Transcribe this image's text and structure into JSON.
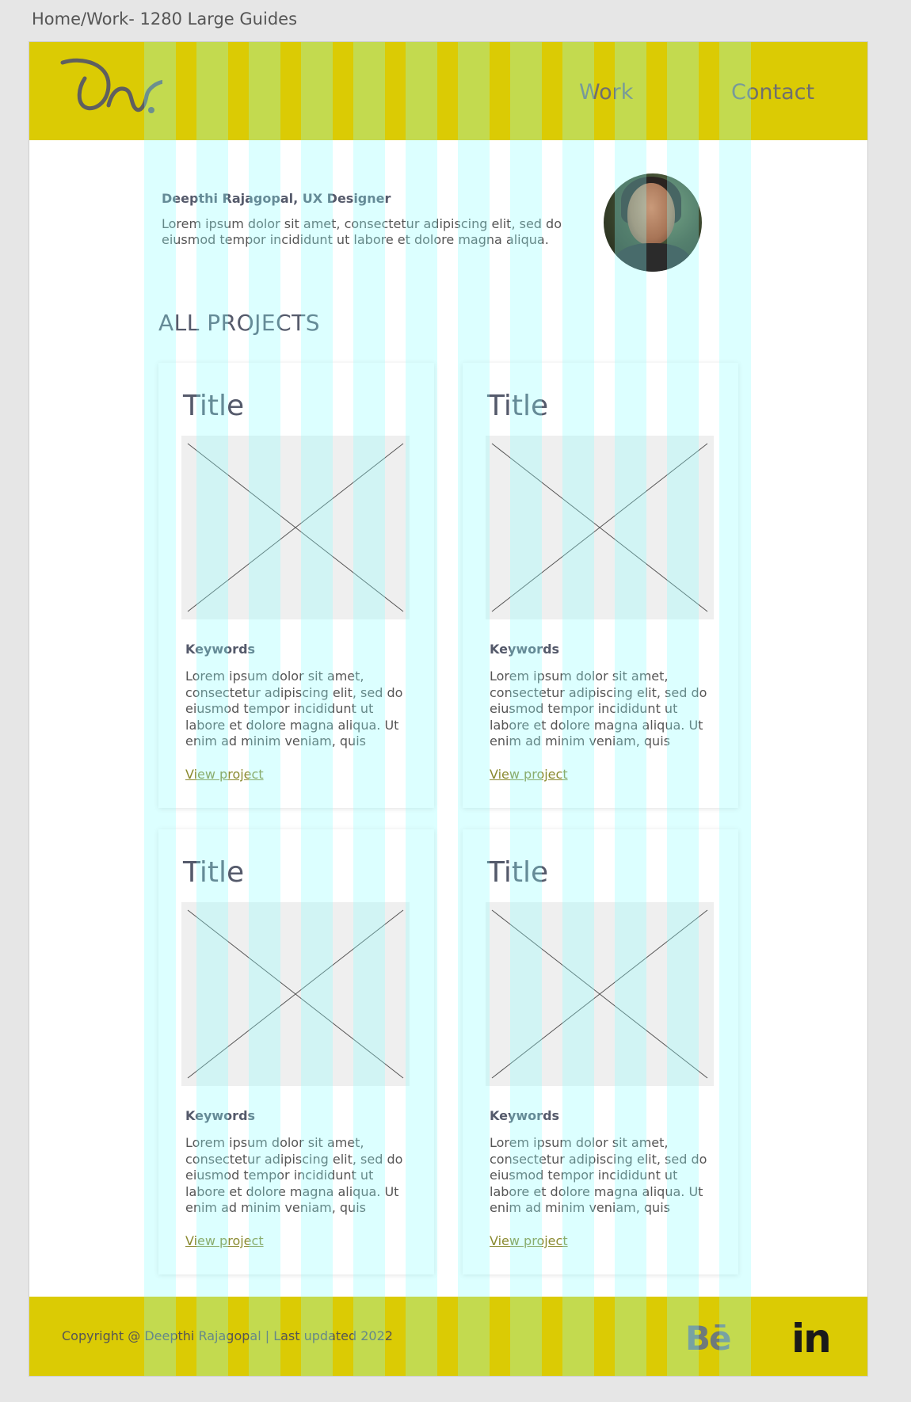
{
  "frame": {
    "label": "Home/Work- 1280 Large Guides"
  },
  "header": {
    "nav": [
      {
        "label": "Work"
      },
      {
        "label": "Contact"
      }
    ]
  },
  "intro": {
    "name": "Deepthi Rajagopal, UX Designer",
    "text": "Lorem ipsum dolor sit amet, consectetur adipiscing elit, sed do eiusmod tempor incididunt ut labore et dolore magna aliqua."
  },
  "projects": {
    "heading": "ALL PROJECTS",
    "cards": [
      {
        "title": "Title",
        "keywords": "Keywords",
        "description": "Lorem ipsum dolor sit amet, consectetur adipiscing elit, sed do eiusmod tempor incididunt ut labore et dolore magna aliqua. Ut enim ad minim veniam, quis",
        "link": "View project"
      },
      {
        "title": "Title",
        "keywords": "Keywords",
        "description": "Lorem ipsum dolor sit amet, consectetur adipiscing elit, sed do eiusmod tempor incididunt ut labore et dolore magna aliqua. Ut enim ad minim veniam, quis",
        "link": "View project"
      },
      {
        "title": "Title",
        "keywords": "Keywords",
        "description": "Lorem ipsum dolor sit amet, consectetur adipiscing elit, sed do eiusmod tempor incididunt ut labore et dolore magna aliqua. Ut enim ad minim veniam, quis",
        "link": "View project"
      },
      {
        "title": "Title",
        "keywords": "Keywords",
        "description": "Lorem ipsum dolor sit amet, consectetur adipiscing elit, sed do eiusmod tempor incididunt ut labore et dolore magna aliqua. Ut enim ad minim veniam, quis",
        "link": "View project"
      }
    ]
  },
  "footer": {
    "copyright": "Copyright @ Deepthi Rajagopal | Last updated 2022",
    "social": [
      {
        "label": "Bē",
        "icon": "behance-icon"
      },
      {
        "label": "in",
        "icon": "linkedin-icon"
      }
    ]
  },
  "colors": {
    "accent_yellow": "#dbcb04",
    "guide_cyan": "#8affff",
    "text_dark": "#555a6b"
  }
}
